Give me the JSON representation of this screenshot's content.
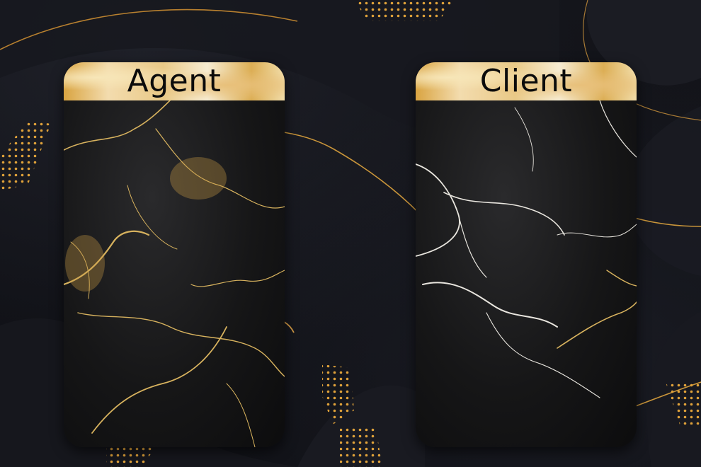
{
  "cards": [
    {
      "title": "Agent",
      "vein_color": "#d7b25e"
    },
    {
      "title": "Client",
      "vein_color": "#e9e6df"
    }
  ],
  "colors": {
    "background": "#0f1015",
    "gold": "#c9953a",
    "dots": "#e0a23a"
  }
}
